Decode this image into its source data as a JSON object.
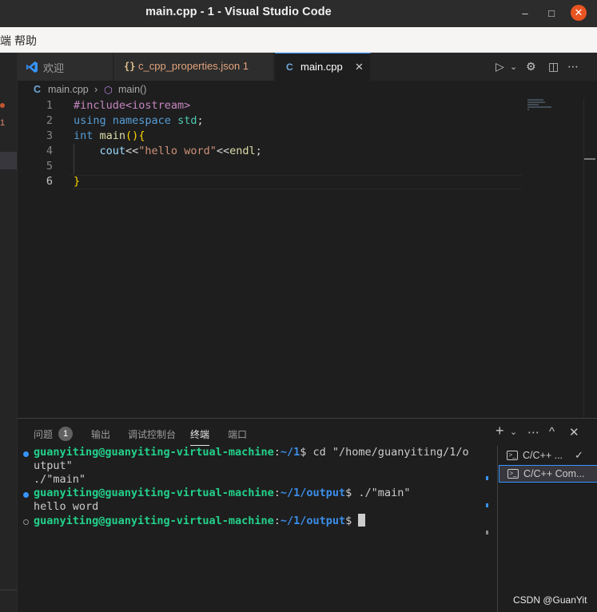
{
  "window": {
    "title": "main.cpp - 1 - Visual Studio Code",
    "minimize_glyph": "–",
    "maximize_glyph": "□",
    "close_glyph": "✕"
  },
  "menu": {
    "items": [
      "端",
      "帮助"
    ]
  },
  "sidebar": {
    "badge": "1"
  },
  "tabs": [
    {
      "label": "欢迎",
      "icon": "vscode-logo-icon",
      "active": false
    },
    {
      "label": "c_cpp_properties.json 1",
      "icon": "json-braces-icon",
      "icon_glyph": "{}",
      "active": false,
      "color": "#e2a37c"
    },
    {
      "label": "main.cpp",
      "icon": "cpp-file-icon",
      "icon_glyph": "C",
      "active": true,
      "close": "✕"
    }
  ],
  "tab_actions": {
    "run": "▷",
    "run_dropdown": "⌄",
    "settings": "⚙",
    "split": "◫",
    "more": "⋯"
  },
  "breadcrumb": {
    "file": "main.cpp",
    "separator": "›",
    "symbol": "main()"
  },
  "editor": {
    "lines": [
      {
        "no": "1",
        "text": "#include<iostream>"
      },
      {
        "no": "2",
        "text": "using namespace std;"
      },
      {
        "no": "3",
        "text": "int main(){"
      },
      {
        "no": "4",
        "text": "    cout<<\"hello word\"<<endl;"
      },
      {
        "no": "5",
        "text": ""
      },
      {
        "no": "6",
        "text": "}"
      }
    ],
    "current_line": "6"
  },
  "panel": {
    "tabs": [
      "问题",
      "输出",
      "调试控制台",
      "终端",
      "端口"
    ],
    "active_tab": "终端",
    "problems_count": "1",
    "actions": {
      "add": "+",
      "dropdown": "⌄",
      "more": "⋯",
      "maximize": "^",
      "close": "✕"
    }
  },
  "terminal": {
    "user": "guanyiting@guanyiting-virtual-machine",
    "lines": [
      {
        "path": "~/1",
        "cmd": " cd \"/home/guanyiting/1/o"
      },
      {
        "text": "utput\""
      },
      {
        "text": "./\"main\""
      },
      {
        "path": "~/1/output",
        "cmd": " ./\"main\""
      },
      {
        "text": "hello word"
      },
      {
        "path": "~/1/output",
        "cmd": " "
      }
    ],
    "sessions": [
      {
        "label": "C/C++ ...",
        "check": "✓"
      },
      {
        "label": "C/C++ Com..."
      }
    ]
  },
  "watermark": "CSDN @GuanYit"
}
